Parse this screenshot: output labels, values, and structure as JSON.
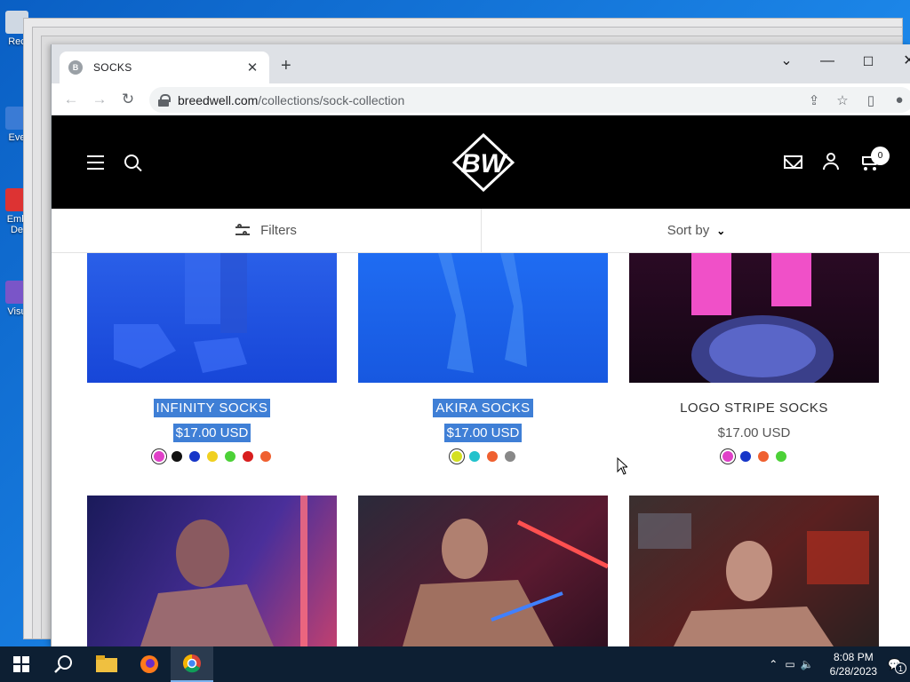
{
  "desktop": {
    "icons": [
      {
        "label": "Rec"
      },
      {
        "label": "Eve"
      },
      {
        "label": "Emb De"
      },
      {
        "label": "Visu"
      }
    ]
  },
  "browser": {
    "tab_title": "SOCKS",
    "url_domain": "breedwell.com",
    "url_path": "/collections/sock-collection"
  },
  "site": {
    "logo_text": "BW",
    "cart_count": "0",
    "filters_label": "Filters",
    "sort_label": "Sort by"
  },
  "products": [
    {
      "name": "INFINITY SOCKS",
      "price": "$17.00 USD",
      "swatches": [
        "#e040c8",
        "#111111",
        "#1736c8",
        "#f0d020",
        "#4cd137",
        "#d81e1e",
        "#ef6030"
      ]
    },
    {
      "name": "AKIRA SOCKS",
      "price": "$17.00 USD",
      "swatches": [
        "#d4e020",
        "#22c2cc",
        "#ef6030",
        "#888888"
      ]
    },
    {
      "name": "LOGO STRIPE SOCKS",
      "price": "$17.00 USD",
      "swatches": [
        "#e040c8",
        "#1736c8",
        "#ef6030",
        "#4cd137"
      ]
    }
  ],
  "taskbar": {
    "time": "8:08 PM",
    "date": "6/28/2023",
    "notification_count": "1"
  },
  "colors": {
    "selection": "#3f7fd6",
    "header_bg": "#000000",
    "desktop": "#1c86e8"
  }
}
